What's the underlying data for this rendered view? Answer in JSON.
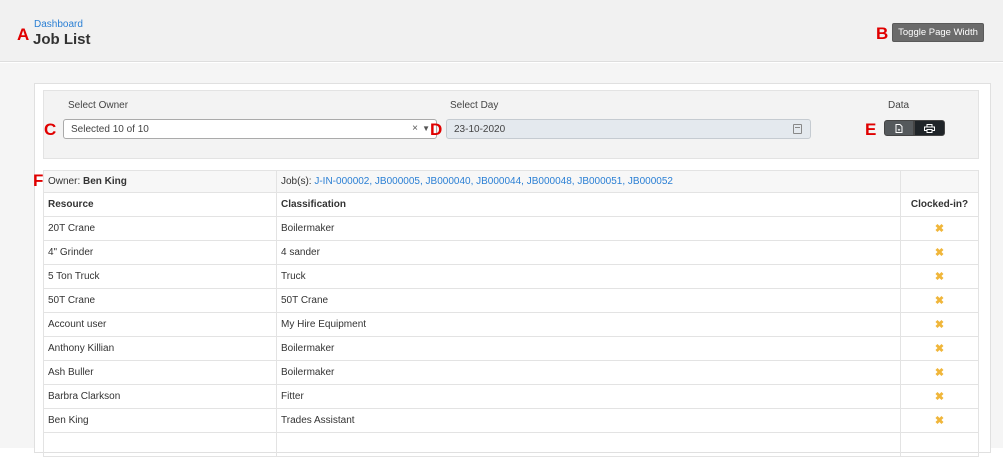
{
  "header": {
    "breadcrumb": "Dashboard",
    "title": "Job List",
    "toggle_label": "Toggle Page Width"
  },
  "markers": {
    "a": "A",
    "b": "B",
    "c": "C",
    "d": "D",
    "e": "E",
    "f": "F"
  },
  "filters": {
    "owner_label": "Select Owner",
    "owner_value": "Selected 10 of 10",
    "owner_clear": "×",
    "owner_caret": "▼",
    "day_label": "Select Day",
    "day_value": "23-10-2020",
    "data_label": "Data"
  },
  "owner_row": {
    "owner_prefix": "Owner: ",
    "owner_name": "Ben King",
    "jobs_prefix": "Job(s): ",
    "jobs": "J-IN-000002, JB000005, JB000040, JB000044, JB000048, JB000051, JB000052"
  },
  "table": {
    "columns": [
      "Resource",
      "Classification",
      "Clocked-in?"
    ],
    "rows": [
      {
        "resource": "20T Crane",
        "classification": "Boilermaker",
        "clocked": "✖"
      },
      {
        "resource": "4\" Grinder",
        "classification": "4 sander",
        "clocked": "✖"
      },
      {
        "resource": "5 Ton Truck",
        "classification": "Truck",
        "clocked": "✖"
      },
      {
        "resource": "50T Crane",
        "classification": "50T Crane",
        "clocked": "✖"
      },
      {
        "resource": "Account user",
        "classification": "My Hire Equipment",
        "clocked": "✖"
      },
      {
        "resource": "Anthony Killian",
        "classification": "Boilermaker",
        "clocked": "✖"
      },
      {
        "resource": "Ash Buller",
        "classification": "Boilermaker",
        "clocked": "✖"
      },
      {
        "resource": "Barbra Clarkson",
        "classification": "Fitter",
        "clocked": "✖"
      },
      {
        "resource": "Ben King",
        "classification": "Trades Assistant",
        "clocked": "✖"
      },
      {
        "resource": "",
        "classification": "",
        "clocked": ""
      }
    ]
  },
  "colors": {
    "marker": "#e00000",
    "link": "#2a7fd4",
    "not_clocked": "#f0b63a",
    "toggle_button": "#6b6b6b"
  },
  "icons": {
    "export": "file-export-icon",
    "print": "print-icon",
    "calendar": "calendar-icon",
    "not_clocked": "x-icon"
  }
}
